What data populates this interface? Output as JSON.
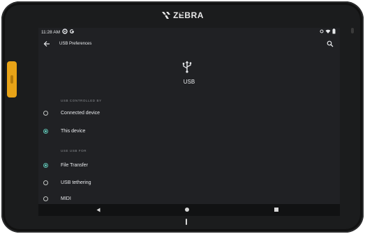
{
  "device": {
    "brand": "ZEBRA"
  },
  "status_bar": {
    "time": "11:28 AM"
  },
  "app_bar": {
    "title": "USB Preferences"
  },
  "header": {
    "title": "USB"
  },
  "sections": [
    {
      "label": "USB CONTROLLED BY",
      "options": [
        {
          "label": "Connected device",
          "selected": false
        },
        {
          "label": "This device",
          "selected": true
        }
      ]
    },
    {
      "label": "USE USB FOR",
      "options": [
        {
          "label": "File Transfer",
          "selected": true
        },
        {
          "label": "USB tethering",
          "selected": false
        },
        {
          "label": "MIDI",
          "selected": false
        }
      ]
    }
  ],
  "colors": {
    "accent": "#5fc2b3",
    "background": "#202124",
    "side_button": "#e8a317"
  }
}
